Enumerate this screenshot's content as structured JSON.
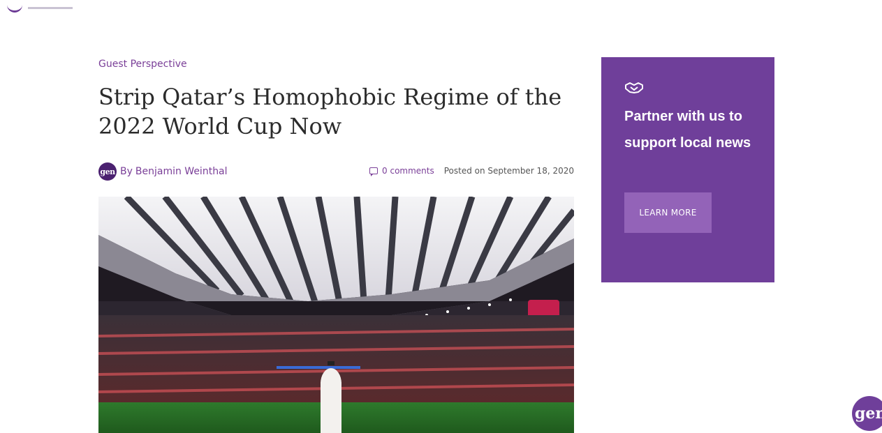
{
  "brand": {
    "primary_color": "#6f3f9a",
    "link_color": "#7a3f98",
    "button_color": "#9363b8"
  },
  "article": {
    "category": "Guest Perspective",
    "title": "Strip Qatar’s Homophobic Regime of the 2022 World Cup Now",
    "author_avatar_text": "gen",
    "author_prefix": "By",
    "author_name": "Benjamin Weinthal",
    "comments_label": "0 comments",
    "posted": "Posted on September 18, 2020",
    "hero_image_icon": "stadium-photo"
  },
  "sidebar": {
    "icon": "handshake-icon",
    "title": "Partner with us to support local news",
    "button_label": "LEARN MORE"
  },
  "chat_widget": {
    "label": "gen"
  }
}
